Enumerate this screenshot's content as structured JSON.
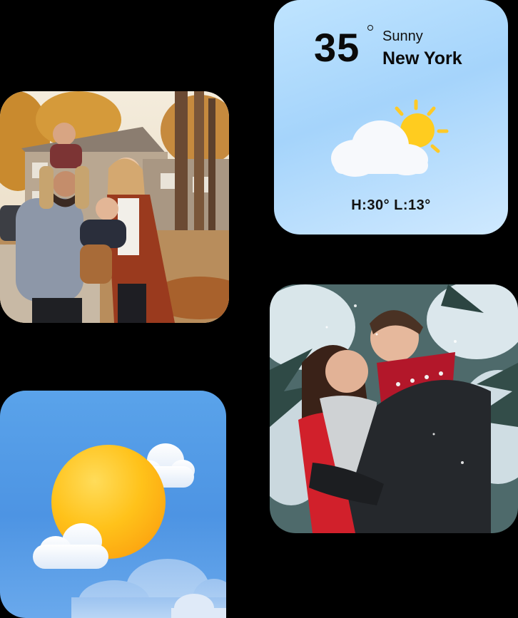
{
  "weather_widget": {
    "temperature": "35",
    "condition": "Sunny",
    "city": "New York",
    "high_low": "H:30° L:13°",
    "icon": "partly-sunny-icon"
  },
  "photo_widgets": [
    {
      "name": "family-photo",
      "description_icon": "photo-image"
    },
    {
      "name": "couple-photo",
      "description_icon": "photo-image"
    }
  ],
  "sun_widget": {
    "icon": "sun-with-clouds-icon"
  },
  "colors": {
    "background": "#000000",
    "weather_bg": "#a5d4fb",
    "sun_widget_bg": "#4d94e3",
    "sun_yellow": "#ffc21a",
    "cloud_white": "#ffffff"
  }
}
